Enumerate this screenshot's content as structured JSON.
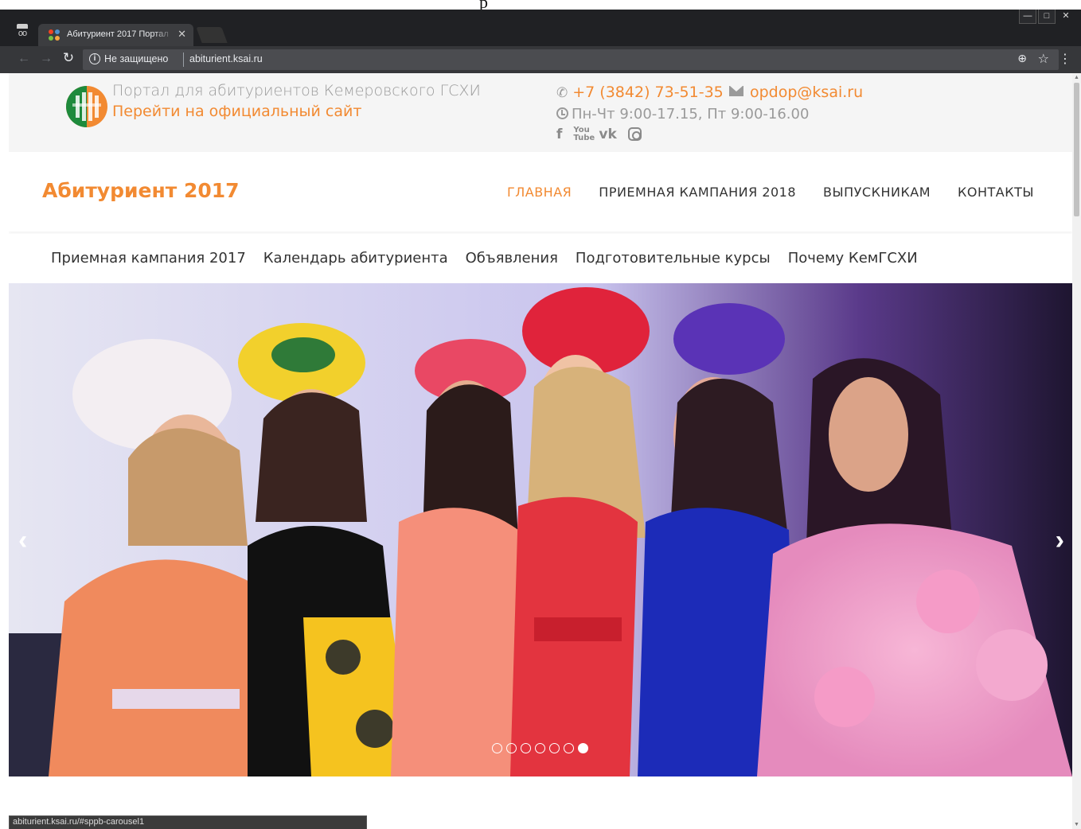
{
  "browser": {
    "tab_title": "Абитуриент 2017 Портал",
    "security_text": "Не защищено",
    "url": "abiturient.ksai.ru",
    "status_url": "abiturient.ksai.ru/#sppb-carousel1"
  },
  "top_mark": "р",
  "topbar": {
    "portal_title": "Портал для абитуриентов Кемеровского ГСХИ",
    "official_link": "Перейти на официальный сайт",
    "phone": "+7 (3842) 73-51-35",
    "email": "opdop@ksai.ru",
    "hours": "Пн-Чт 9:00-17.15, Пт 9:00-16.00",
    "social": [
      "facebook-icon",
      "youtube-icon",
      "vk-icon",
      "instagram-icon"
    ],
    "social_labels": {
      "facebook": "f",
      "youtube": "You Tube",
      "vk": "vk"
    }
  },
  "header": {
    "site_title": "Абитуриент 2017",
    "nav": [
      {
        "label": "ГЛАВНАЯ",
        "active": true
      },
      {
        "label": "ПРИЕМНАЯ КАМПАНИЯ 2018",
        "active": false
      },
      {
        "label": "ВЫПУСКНИКАМ",
        "active": false
      },
      {
        "label": "КОНТАКТЫ",
        "active": false
      }
    ]
  },
  "subnav": [
    "Приемная кампания 2017",
    "Календарь абитуриента",
    "Объявления",
    "Подготовительные курсы",
    "Почему КемГСХИ"
  ],
  "carousel": {
    "slide_count": 7,
    "active_index": 6,
    "prev_label": "‹",
    "next_label": "›"
  },
  "colors": {
    "accent": "#f28a32",
    "topbar_bg": "#f5f5f5",
    "text_gray": "#9a9a9a"
  }
}
